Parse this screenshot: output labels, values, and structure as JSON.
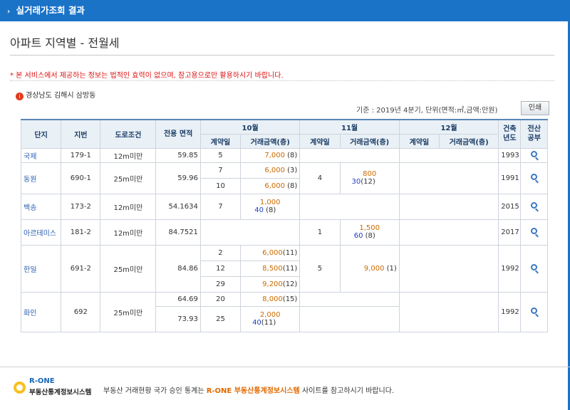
{
  "header": {
    "title": "실거래가조회 결과"
  },
  "page_title": "아파트 지역별 - 전월세",
  "notice": "* 본 서비스에서 제공하는 정보는 법적인 효력이 없으며, 참고용으로만 활용하시기 바랍니다.",
  "region": "경상남도 김해시 삼방동",
  "basis": "기준 : 2019년 4분기, 단위(면적:㎡,금액:만원)",
  "print_label": "인쇄",
  "columns": {
    "complex": "단지",
    "lot": "지번",
    "road": "도로조건",
    "area": "전용 면적",
    "month1": "10월",
    "month2": "11월",
    "month3": "12월",
    "contract_day": "계약일",
    "amount": "거래금액(층)",
    "built_year": "건축 년도",
    "registry": "전산 공부"
  },
  "rows": [
    {
      "name": "국제",
      "lot": "179-1",
      "road": "12m미만",
      "area": "59.85",
      "oct_day": "5",
      "oct_amt": "7,000",
      "oct_floor": "(8)",
      "year": "1993"
    },
    {
      "name": "동원",
      "lot": "690-1",
      "road": "25m미만",
      "area": "59.96",
      "oct1_day": "7",
      "oct1_amt": "6,000",
      "oct1_floor": "(3)",
      "oct2_day": "10",
      "oct2_amt": "6,000",
      "oct2_floor": "(8)",
      "nov_day": "4",
      "nov_dep": "800",
      "nov_rent": "30",
      "nov_floor": "(12)",
      "year": "1991"
    },
    {
      "name": "백송",
      "lot": "173-2",
      "road": "12m미만",
      "area": "54.1634",
      "oct_day": "7",
      "oct_dep": "1,000",
      "oct_rent": "40",
      "oct_floor": "(8)",
      "year": "2015"
    },
    {
      "name": "아르테미스",
      "lot": "181-2",
      "road": "12m미만",
      "area": "84.7521",
      "nov_day": "1",
      "nov_dep": "1,500",
      "nov_rent": "60",
      "nov_floor": "(8)",
      "year": "2017"
    },
    {
      "name": "한일",
      "lot": "691-2",
      "road": "25m미만",
      "area": "84.86",
      "oct1_day": "2",
      "oct1_amt": "6,000",
      "oct1_floor": "(11)",
      "oct2_day": "12",
      "oct2_amt": "8,500",
      "oct2_floor": "(11)",
      "oct3_day": "29",
      "oct3_amt": "9,200",
      "oct3_floor": "(12)",
      "nov_day": "5",
      "nov_amt": "9,000",
      "nov_floor": "(1)",
      "year": "1992"
    },
    {
      "name": "화인",
      "lot": "692",
      "road": "25m미만",
      "area1": "64.69",
      "oct1_day": "20",
      "oct1_amt": "8,000",
      "oct1_floor": "(15)",
      "area2": "73.93",
      "oct2_day": "25",
      "oct2_dep": "2,000",
      "oct2_rent": "40",
      "oct2_floor": "(11)",
      "year": "1992"
    }
  ],
  "footer": {
    "logo_brand": "R-ONE",
    "logo_sub": "부동산통계정보시스템",
    "text_before": "부동산 거래현황 국가 승인 통계는",
    "text_highlight": "R-ONE 부동산통계정보시스템",
    "text_after": "사이트를 참고하시기 바랍니다."
  }
}
